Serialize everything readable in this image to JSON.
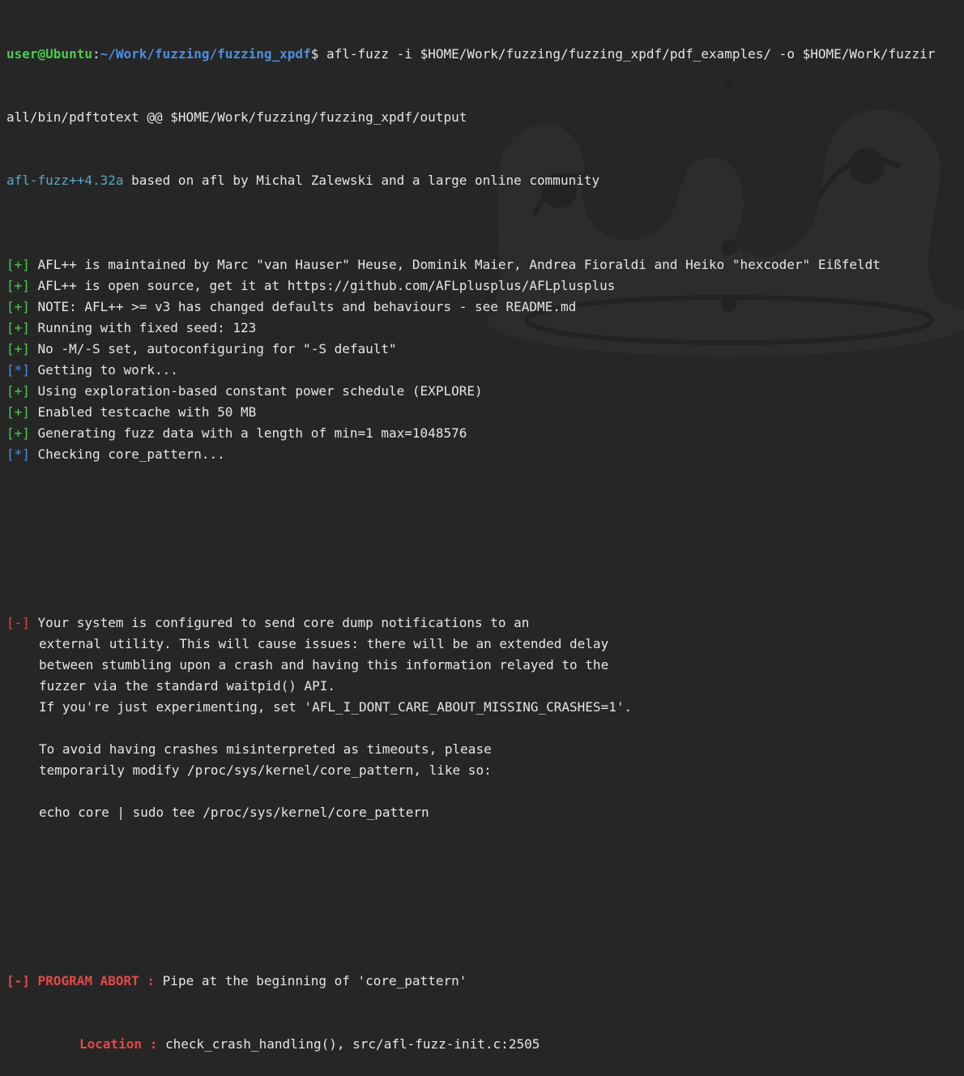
{
  "terminal": {
    "prompt_user": "user@Ubuntu",
    "prompt_sep": ":",
    "prompt_path": "~/Work/fuzzing/fuzzing_xpdf",
    "prompt_symbol": "$",
    "command_1": " afl-fuzz -i $HOME/Work/fuzzing/fuzzing_xpdf/pdf_examples/ -o $HOME/Work/fuzzir",
    "command_2": "all/bin/pdftotext @@ $HOME/Work/fuzzing/fuzzing_xpdf/output",
    "banner_version": "afl-fuzz++4.32a",
    "banner_rest": " based on afl by Michal Zalewski and a large online community",
    "messages": [
      {
        "tag": "[+]",
        "kind": "ok",
        "text": " AFL++ is maintained by Marc \"van Hauser\" Heuse, Dominik Maier, Andrea Fioraldi and Heiko \"hexcoder\" Eißfeldt"
      },
      {
        "tag": "[+]",
        "kind": "ok",
        "text": " AFL++ is open source, get it at https://github.com/AFLplusplus/AFLplusplus"
      },
      {
        "tag": "[+]",
        "kind": "ok",
        "text": " NOTE: AFL++ >= v3 has changed defaults and behaviours - see README.md"
      },
      {
        "tag": "[+]",
        "kind": "ok",
        "text": " Running with fixed seed: 123"
      },
      {
        "tag": "[+]",
        "kind": "ok",
        "text": " No -M/-S set, autoconfiguring for \"-S default\""
      },
      {
        "tag": "[*]",
        "kind": "info",
        "text": " Getting to work..."
      },
      {
        "tag": "[+]",
        "kind": "ok",
        "text": " Using exploration-based constant power schedule (EXPLORE)"
      },
      {
        "tag": "[+]",
        "kind": "ok",
        "text": " Enabled testcache with 50 MB"
      },
      {
        "tag": "[+]",
        "kind": "ok",
        "text": " Generating fuzz data with a length of min=1 max=1048576"
      },
      {
        "tag": "[*]",
        "kind": "info",
        "text": " Checking core_pattern..."
      }
    ],
    "warning_tag": "[-]",
    "warning_lines": [
      " Your system is configured to send core dump notifications to an",
      "external utility. This will cause issues: there will be an extended delay",
      "between stumbling upon a crash and having this information relayed to the",
      "fuzzer via the standard waitpid() API.",
      "If you're just experimenting, set 'AFL_I_DONT_CARE_ABOUT_MISSING_CRASHES=1'.",
      "",
      "To avoid having crashes misinterpreted as timeouts, please",
      "temporarily modify /proc/sys/kernel/core_pattern, like so:",
      "",
      "echo core | sudo tee /proc/sys/kernel/core_pattern"
    ],
    "abort_tag": "[-]",
    "abort_label": " PROGRAM ABORT : ",
    "abort_text": "Pipe at the beginning of 'core_pattern'",
    "location_label": "Location : ",
    "location_text": "check_crash_handling(), src/afl-fuzz-init.c:2505"
  },
  "colors": {
    "background": "#262626",
    "ok": "#4ec94e",
    "info": "#4a90e2",
    "error": "#e24848",
    "text": "#e6e6e6"
  }
}
